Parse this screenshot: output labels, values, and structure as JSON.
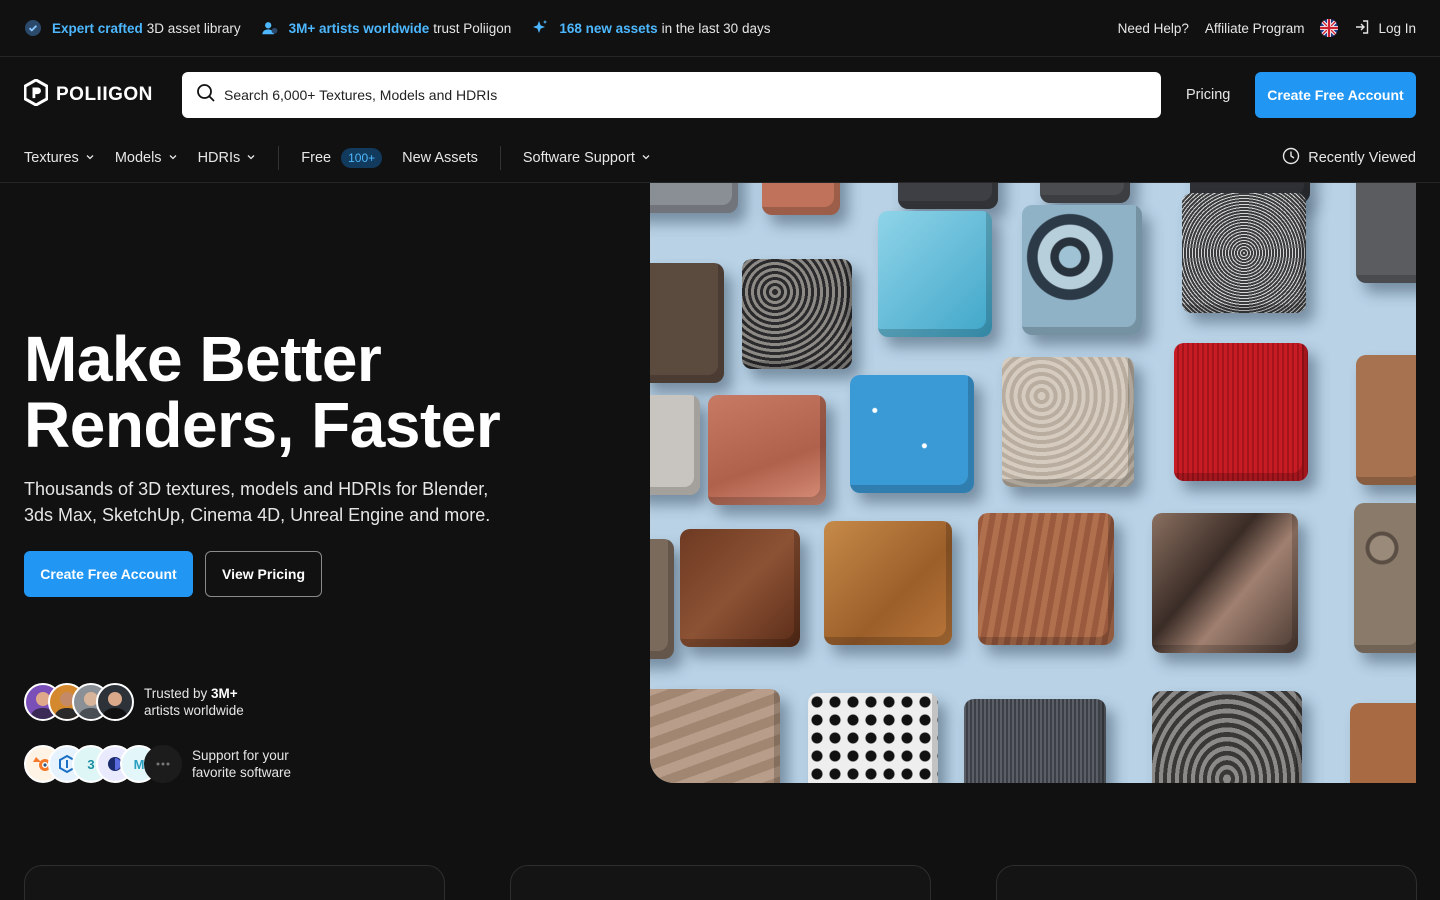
{
  "topbar": {
    "promos": [
      {
        "highlight": "Expert crafted",
        "text": "3D asset library",
        "icon": "verified-badge-icon"
      },
      {
        "highlight": "3M+ artists worldwide",
        "text": "trust Poliigon",
        "icon": "users-icon"
      },
      {
        "highlight": "168 new assets",
        "text": "in the last 30 days",
        "icon": "sparkle-icon"
      }
    ],
    "help": "Need Help?",
    "affiliate": "Affiliate Program",
    "login": "Log In"
  },
  "header": {
    "logo_text": "POLIIGON",
    "search_placeholder": "Search 6,000+ Textures, Models and HDRIs",
    "pricing": "Pricing",
    "cta": "Create Free Account"
  },
  "nav": {
    "textures": "Textures",
    "models": "Models",
    "hdris": "HDRIs",
    "free": "Free",
    "free_badge": "100+",
    "new_assets": "New Assets",
    "software_support": "Software Support",
    "recently_viewed": "Recently Viewed"
  },
  "hero": {
    "title_line1": "Make Better",
    "title_line2": "Renders, Faster",
    "subtitle_line1": "Thousands of 3D textures, models and HDRIs for Blender,",
    "subtitle_line2": "3ds Max, SketchUp, Cinema 4D, Unreal Engine and more.",
    "cta_primary": "Create Free Account",
    "cta_secondary": "View Pricing",
    "trust_prefix": "Trusted by",
    "trust_count": "3M+",
    "trust_suffix": "artists worldwide",
    "software_line1": "Support for your",
    "software_line2": "favorite software",
    "software_icons": [
      "3",
      "M"
    ]
  },
  "colors": {
    "background": "#111111",
    "accent": "#2196f3",
    "highlight": "#4db8ff"
  }
}
